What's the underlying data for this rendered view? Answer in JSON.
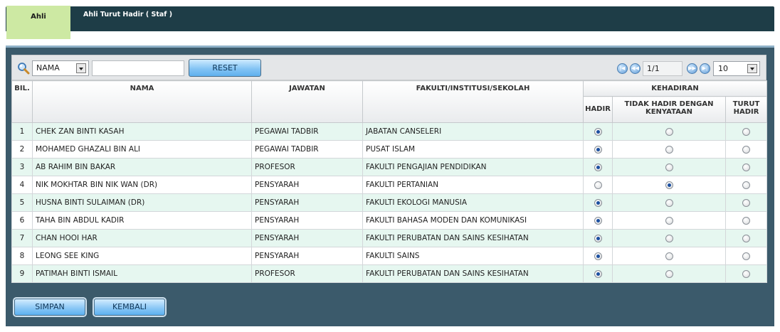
{
  "tabs": {
    "active": "Ahli",
    "inactive": "Ahli Turut Hadir ( Staf )"
  },
  "toolbar": {
    "search_field": "NAMA",
    "search_value": "",
    "reset_label": "RESET",
    "page_value": "1/1",
    "page_size": "10"
  },
  "table": {
    "headers": {
      "bil": "BIL.",
      "nama": "NAMA",
      "jawatan": "JAWATAN",
      "fakulti": "FAKULTI/INSTITUSI/SEKOLAH",
      "kehadiran": "KEHADIRAN",
      "hadir": "HADIR",
      "tidak_hadir": "TIDAK HADIR DENGAN KENYATAAN",
      "turut_hadir": "TURUT HADIR"
    },
    "rows": [
      {
        "bil": "1",
        "nama": "CHEK ZAN BINTI KASAH",
        "jawatan": "PEGAWAI TADBIR",
        "fakulti": "JABATAN CANSELERI",
        "attendance": "hadir"
      },
      {
        "bil": "2",
        "nama": "MOHAMED GHAZALI BIN ALI",
        "jawatan": "PEGAWAI TADBIR",
        "fakulti": "PUSAT ISLAM",
        "attendance": "hadir"
      },
      {
        "bil": "3",
        "nama": "AB RAHIM BIN BAKAR",
        "jawatan": "PROFESOR",
        "fakulti": "FAKULTI PENGAJIAN PENDIDIKAN",
        "attendance": "hadir"
      },
      {
        "bil": "4",
        "nama": "NIK MOKHTAR BIN NIK WAN (DR)",
        "jawatan": "PENSYARAH",
        "fakulti": "FAKULTI PERTANIAN",
        "attendance": "tidak_hadir"
      },
      {
        "bil": "5",
        "nama": "HUSNA BINTI SULAIMAN (DR)",
        "jawatan": "PENSYARAH",
        "fakulti": "FAKULTI EKOLOGI MANUSIA",
        "attendance": "hadir"
      },
      {
        "bil": "6",
        "nama": "TAHA BIN ABDUL KADIR",
        "jawatan": "PENSYARAH",
        "fakulti": "FAKULTI BAHASA MODEN DAN KOMUNIKASI",
        "attendance": "hadir"
      },
      {
        "bil": "7",
        "nama": "CHAN HOOI HAR",
        "jawatan": "PENSYARAH",
        "fakulti": "FAKULTI PERUBATAN DAN SAINS KESIHATAN",
        "attendance": "hadir"
      },
      {
        "bil": "8",
        "nama": "LEONG SEE KING",
        "jawatan": "PENSYARAH",
        "fakulti": "FAKULTI SAINS",
        "attendance": "hadir"
      },
      {
        "bil": "9",
        "nama": "PATIMAH BINTI ISMAIL",
        "jawatan": "PROFESOR",
        "fakulti": "FAKULTI PERUBATAN DAN SAINS KESIHATAN",
        "attendance": "hadir"
      }
    ]
  },
  "actions": {
    "save_label": "SIMPAN",
    "back_label": "KEMBALI"
  },
  "icons": {
    "search": "magnifier-icon",
    "first": "first-page-icon",
    "prev": "previous-page-icon",
    "next": "next-page-icon",
    "last": "last-page-icon"
  },
  "colors": {
    "tab_bar": "#1e3d47",
    "active_tab": "#cde9a3",
    "panel": "#3b5a6b",
    "row_alt": "#e6f7f0",
    "button": "#84c4f4"
  }
}
